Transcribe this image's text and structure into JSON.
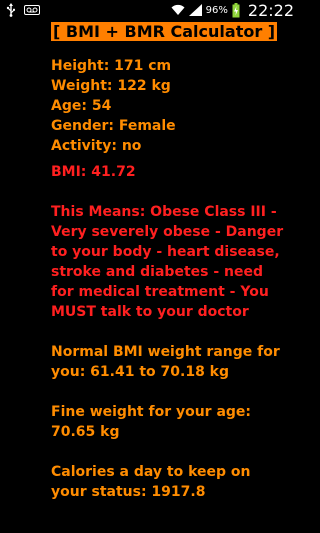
{
  "status_bar": {
    "battery_percent": "96%",
    "time": "22:22",
    "icons": [
      "usb-icon",
      "voicemail-icon",
      "wifi-icon",
      "signal-icon",
      "battery-charging-icon"
    ]
  },
  "app": {
    "title": "[ BMI + BMR Calculator ]",
    "height": "Height: 171 cm",
    "weight": "Weight: 122 kg",
    "age": "Age: 54",
    "gender": "Gender: Female",
    "activity": "Activity: no",
    "bmi": "BMI: 41.72",
    "meaning": "This Means: Obese Class III - Very severely obese - Danger to your body - heart disease, stroke and diabetes - need for medical treatment - You MUST talk to your doctor",
    "normal_range": "Normal BMI weight range for you: 61.41 to 70.18 kg",
    "fine_weight": "Fine weight for your age: 70.65 kg",
    "calories": "Calories a day to keep on your status: 1917.8"
  },
  "colors": {
    "orange": "#ff8c00",
    "red": "#ff2020",
    "title_bg": "#ff7f00",
    "background": "#000000"
  }
}
